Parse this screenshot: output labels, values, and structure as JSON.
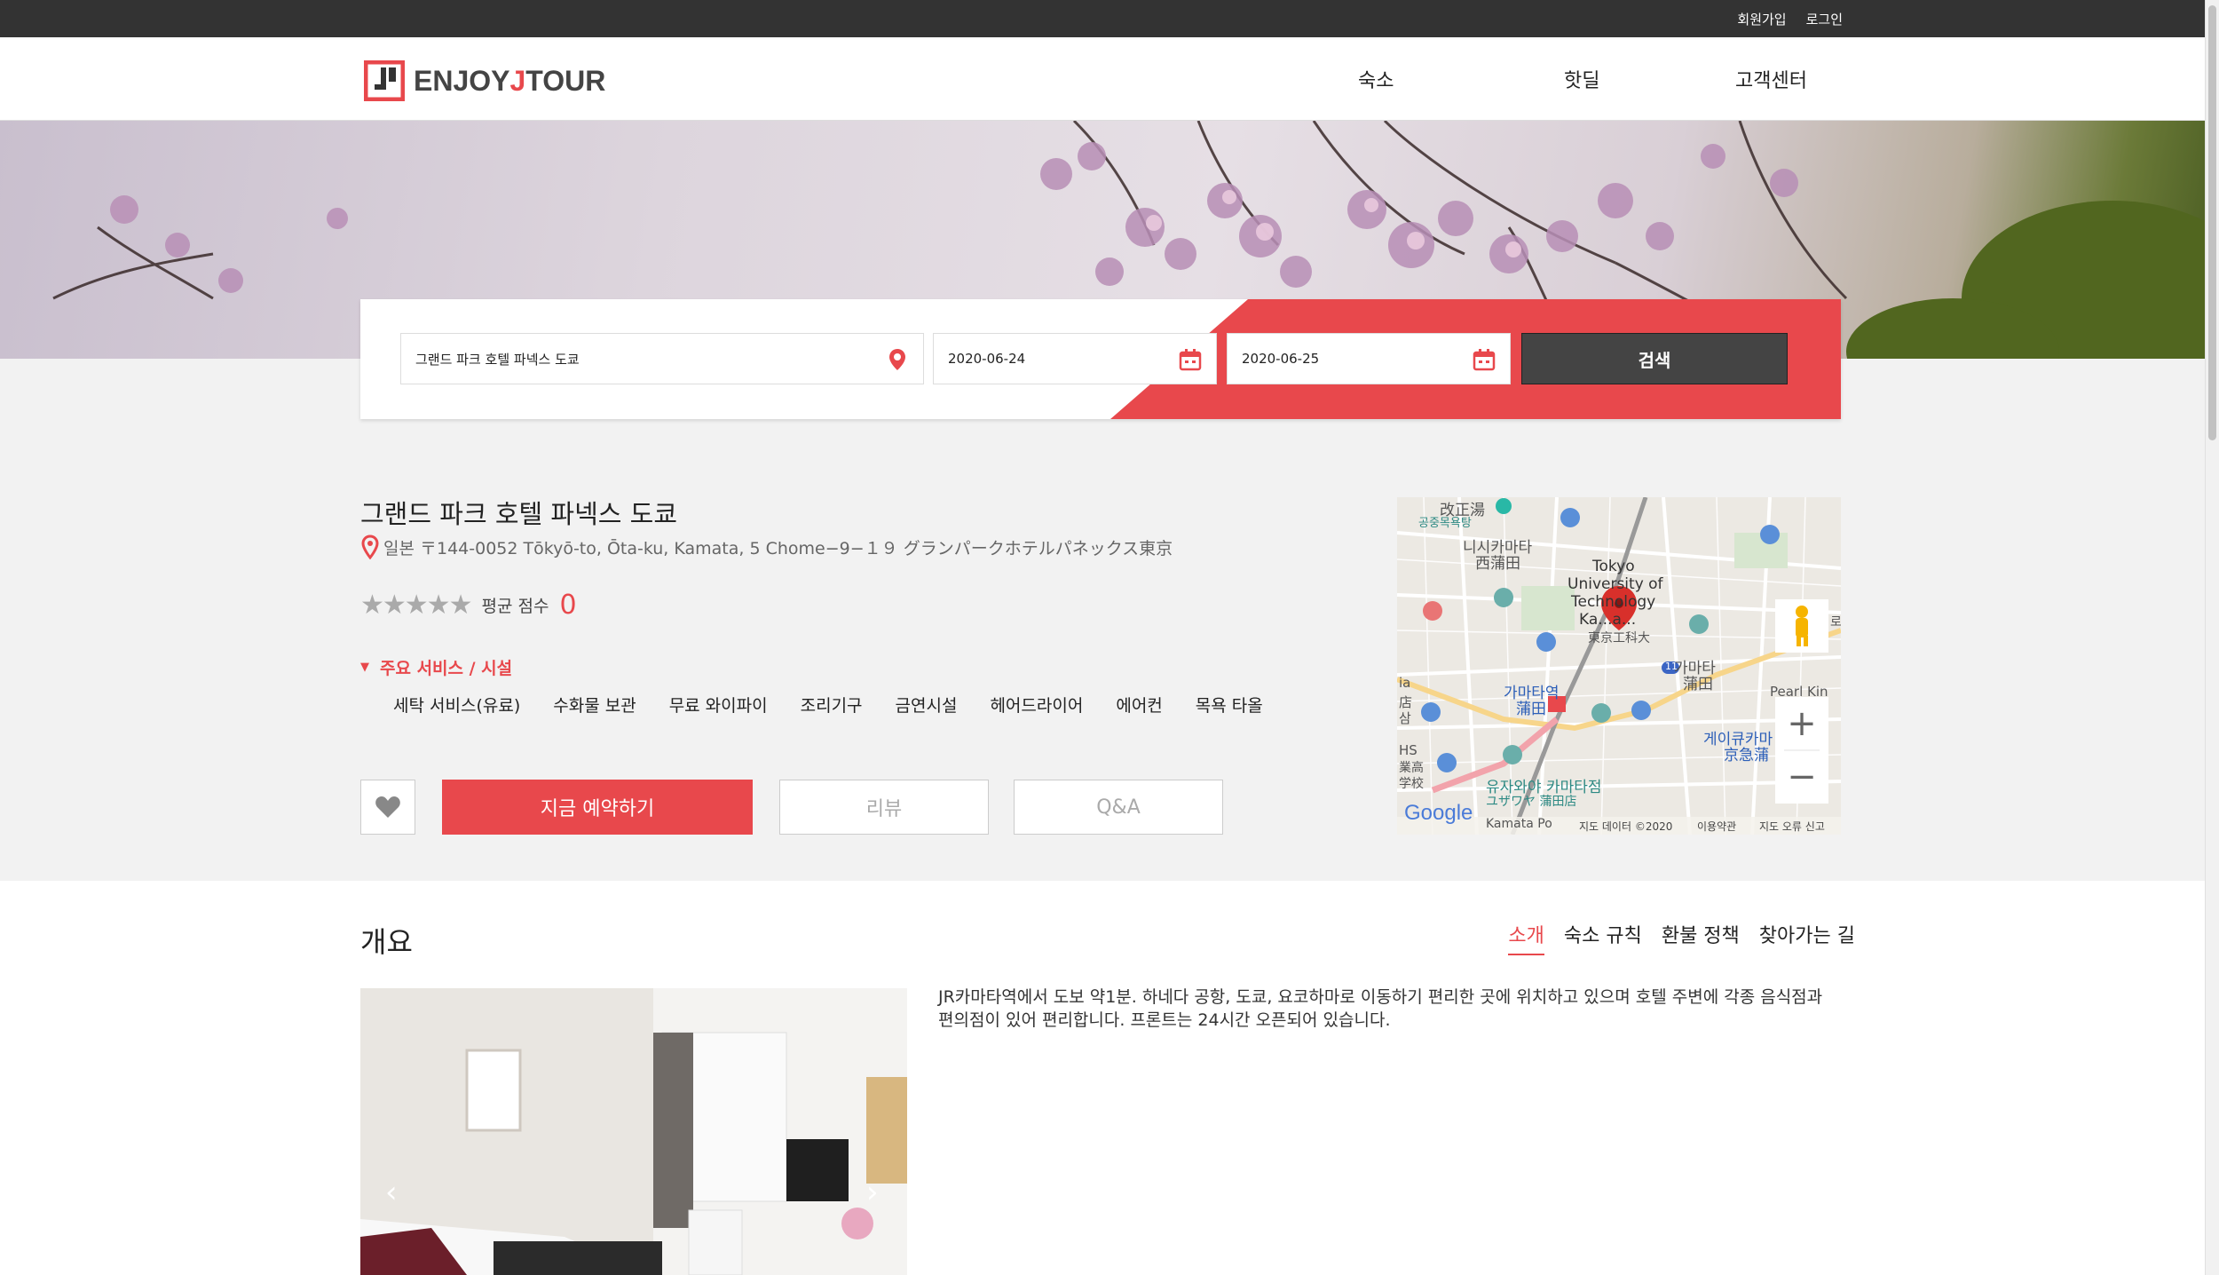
{
  "topbar": {
    "signup": "회원가입",
    "login": "로그인"
  },
  "brand": {
    "name_prefix": "ENJOY",
    "name_j": "J",
    "name_suffix": "TOUR"
  },
  "nav": {
    "stay": "숙소",
    "hotdeal": "핫딜",
    "support": "고객센터"
  },
  "search": {
    "destination": "그랜드 파크 호텔 파넥스 도쿄",
    "checkin": "2020-06-24",
    "checkout": "2020-06-25",
    "button": "검색"
  },
  "hotel": {
    "name": "그랜드 파크 호텔 파넥스 도쿄",
    "address": "일본 〒144-0052 Tōkyō-to, Ōta-ku, Kamata, 5 Chome−9−１９ グランパークホテルパネックス東京",
    "rating_label": "평균 점수",
    "rating_score": "0",
    "rating_stars": 0,
    "services_title": "주요 서비스 / 시설",
    "amenities": [
      "세탁 서비스(유료)",
      "수화물 보관",
      "무료 와이파이",
      "조리기구",
      "금연시설",
      "헤어드라이어",
      "에어컨",
      "목욕 타올"
    ]
  },
  "actions": {
    "book": "지금 예약하기",
    "review": "리뷰",
    "qa": "Q&A"
  },
  "map": {
    "labels": {
      "l1": "改正湯",
      "l2": "공중목욕탕",
      "l3": "니시카마타",
      "l4": "西蒲田",
      "l5": "Tokyo",
      "l6": "University of",
      "l7": "Technology",
      "l8": "Ka...a...",
      "l9": "東京工科大",
      "l10": "가마타",
      "l11": "蒲田",
      "l12": "가마타역",
      "l13": "蒲田",
      "l14": "게이큐카마",
      "l15": "京急蒲",
      "l16": "유자와야 카마타점",
      "l17": "ユザワヤ 蒲田店",
      "l18": "Kamata Po",
      "l19": "Pearl Kin",
      "l20": "ia",
      "l21": "店",
      "l22": "삼",
      "l23": "HS",
      "l24": "業高",
      "l25": "学校",
      "l26": "로",
      "l27": "11"
    },
    "google": "Google",
    "footer": {
      "data": "지도 데이터 ©2020",
      "terms": "이용약관",
      "report": "지도 오류 신고"
    },
    "zoom_in": "+",
    "zoom_out": "−"
  },
  "overview": {
    "title": "개요",
    "tabs": [
      "소개",
      "숙소 규칙",
      "환불 정책",
      "찾아가는 길"
    ],
    "description": "JR카마타역에서 도보 약1분. 하네다 공항, 도쿄, 요코하마로 이동하기 편리한 곳에 위치하고 있으며 호텔 주변에 각종 음식점과 편의점이 있어 편리합니다. 프론트는 24시간 오픈되어 있습니다."
  },
  "colors": {
    "accent": "#e8484c",
    "dark": "#333333",
    "button_dark": "#444444"
  }
}
